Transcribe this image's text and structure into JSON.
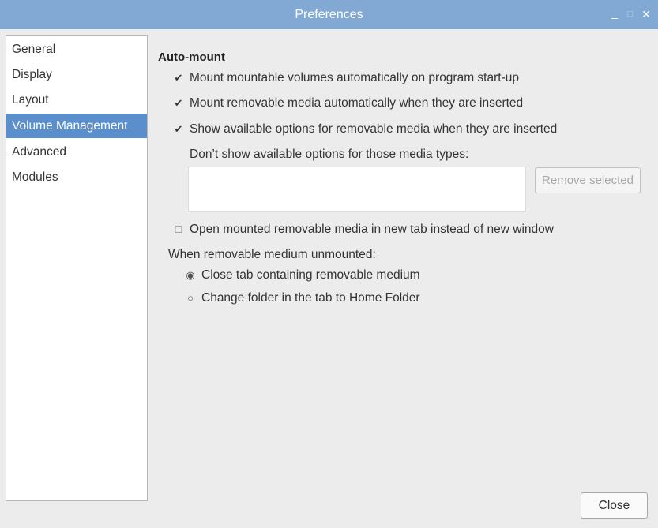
{
  "window": {
    "title": "Preferences",
    "controls": {
      "minimize": "_",
      "maximize": "□",
      "close": "✕"
    }
  },
  "sidebar": {
    "selected_index": 3,
    "items": [
      {
        "label": "General"
      },
      {
        "label": "Display"
      },
      {
        "label": "Layout"
      },
      {
        "label": "Volume Management"
      },
      {
        "label": "Advanced"
      },
      {
        "label": "Modules"
      }
    ]
  },
  "auto_mount": {
    "section_title": "Auto-mount",
    "mount_on_startup": {
      "label": "Mount mountable volumes automatically on program start-up",
      "checked": true
    },
    "mount_removable": {
      "label": "Mount removable media automatically when they are inserted",
      "checked": true
    },
    "show_options": {
      "label": "Show available options for removable media when they are inserted",
      "checked": true
    },
    "dont_show_label": "Don’t show available options for those media types:",
    "media_types": [],
    "remove_selected_label": "Remove selected",
    "open_in_new_tab": {
      "label": "Open mounted removable media in new tab instead of new window",
      "checked": false
    },
    "unmount_heading": "When removable medium unmounted:",
    "unmount_options": [
      {
        "label": "Close tab containing removable medium",
        "selected": true
      },
      {
        "label": "Change folder in the tab to Home Folder",
        "selected": false
      }
    ]
  },
  "footer": {
    "close_label": "Close"
  },
  "glyphs": {
    "check": "✔",
    "uncheck": "☐",
    "radio_on": "◉",
    "radio_off": "○"
  },
  "colors": {
    "titlebar": "#82a9d4",
    "selection": "#5b8fcc",
    "window_bg": "#ececec",
    "panel_bg": "#ffffff"
  }
}
